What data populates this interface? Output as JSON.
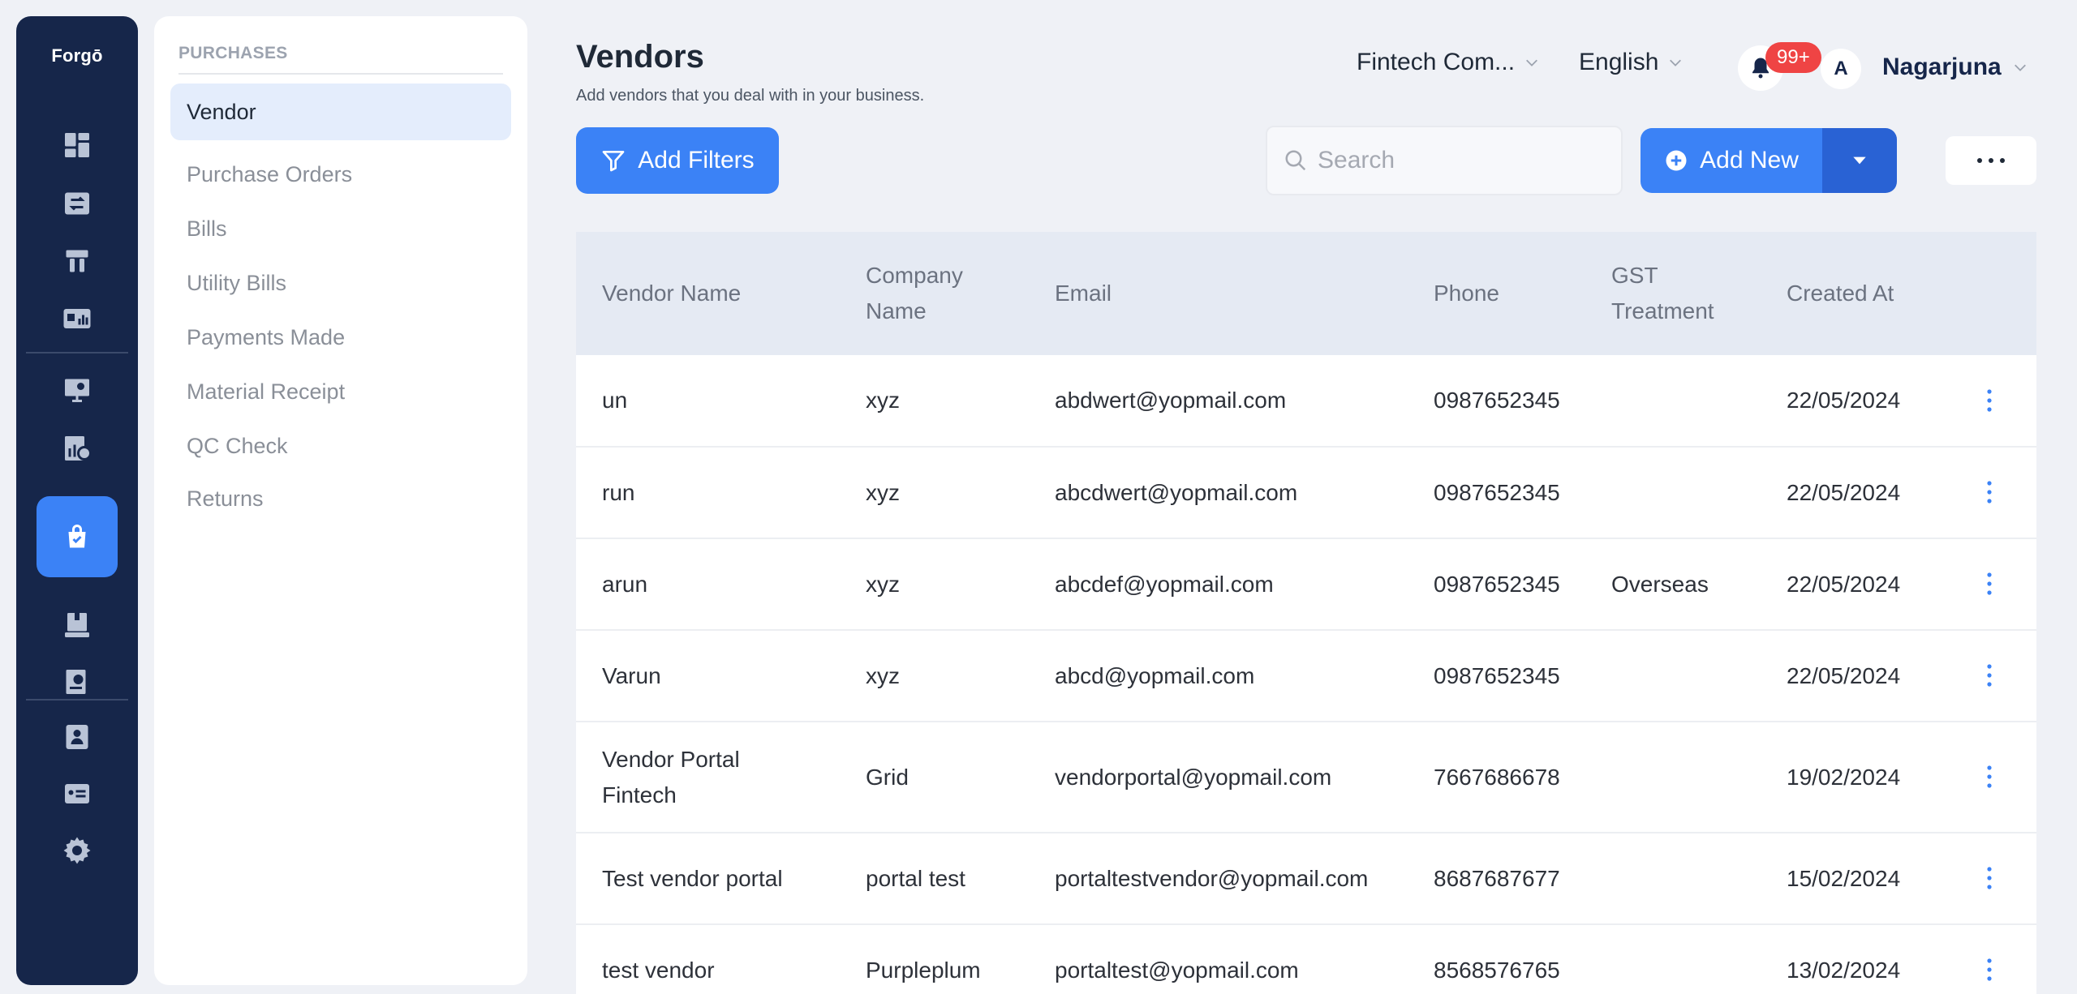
{
  "app": {
    "logo": "Forgō"
  },
  "rail": {
    "icons": [
      "dashboard-icon",
      "transfer-icon",
      "tools-icon",
      "reports-icon",
      "presentation-icon",
      "analytics-icon",
      "purchases-bag-icon",
      "inventory-icon",
      "payroll-icon",
      "contacts-icon",
      "cards-icon",
      "settings-gear-icon"
    ],
    "active": "purchases-bag-icon"
  },
  "subnav": {
    "heading": "PURCHASES",
    "items": [
      {
        "label": "Vendor",
        "active": true
      },
      {
        "label": "Purchase Orders"
      },
      {
        "label": "Bills"
      },
      {
        "label": "Utility Bills"
      },
      {
        "label": "Payments Made"
      },
      {
        "label": "Material Receipt"
      },
      {
        "label": "QC Check"
      },
      {
        "label": "Returns"
      }
    ]
  },
  "header": {
    "title": "Vendors",
    "subtitle": "Add vendors that you deal with in your business.",
    "company": "Fintech Com...",
    "language": "English",
    "notifications_badge": "99+",
    "avatar_initial": "A",
    "user_name": "Nagarjuna"
  },
  "toolbar": {
    "filter_label": "Add Filters",
    "search_placeholder": "Search",
    "add_label": "Add New"
  },
  "table": {
    "columns": [
      "Vendor Name",
      "Company Name",
      "Email",
      "Phone",
      "GST Treatment",
      "Created At"
    ],
    "rows": [
      {
        "vendor": "un",
        "company": "xyz",
        "email": "abdwert@yopmail.com",
        "phone": "0987652345",
        "gst": "",
        "created": "22/05/2024"
      },
      {
        "vendor": "run",
        "company": "xyz",
        "email": "abcdwert@yopmail.com",
        "phone": "0987652345",
        "gst": "",
        "created": "22/05/2024"
      },
      {
        "vendor": "arun",
        "company": "xyz",
        "email": "abcdef@yopmail.com",
        "phone": "0987652345",
        "gst": "Overseas",
        "created": "22/05/2024"
      },
      {
        "vendor": "Varun",
        "company": "xyz",
        "email": "abcd@yopmail.com",
        "phone": "0987652345",
        "gst": "",
        "created": "22/05/2024"
      },
      {
        "vendor": "Vendor Portal Fintech",
        "company": "Grid",
        "email": "vendorportal@yopmail.com",
        "phone": "7667686678",
        "gst": "",
        "created": "19/02/2024"
      },
      {
        "vendor": "Test vendor portal",
        "company": "portal test",
        "email": "portaltestvendor@yopmail.com",
        "phone": "8687687677",
        "gst": "",
        "created": "15/02/2024"
      },
      {
        "vendor": "test vendor",
        "company": "Purpleplum",
        "email": "portaltest@yopmail.com",
        "phone": "8568576765",
        "gst": "",
        "created": "13/02/2024"
      }
    ]
  }
}
